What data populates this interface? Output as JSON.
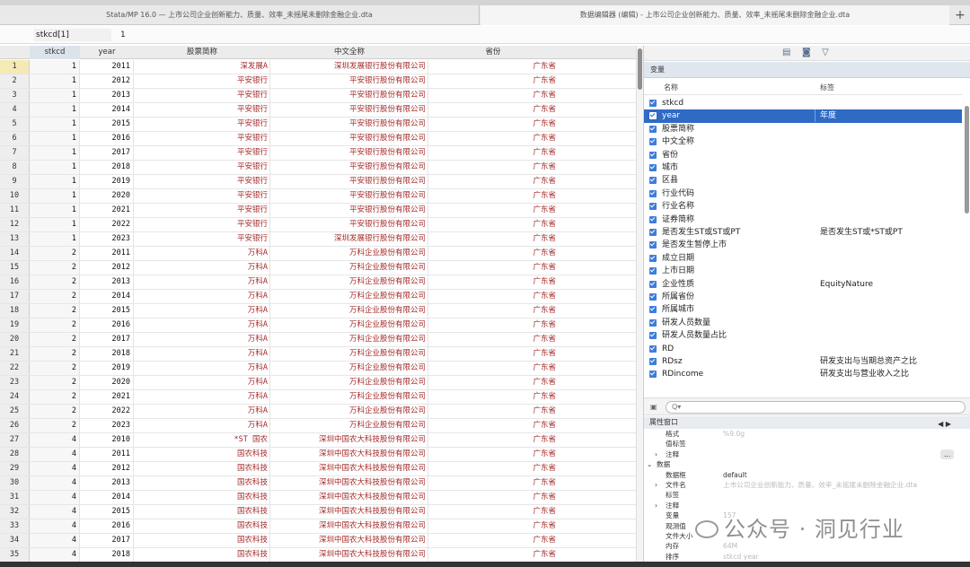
{
  "window": {
    "left_tab": "Stata/MP 16.0 — 上市公司企业创新能力、质量、效率_未摇尾未删除金融企业.dta",
    "right_tab": "数据编辑器 (编辑) - 上市公司企业创新能力、质量、效率_未摇尾未删除金融企业.dta",
    "add_tab": "+"
  },
  "command": {
    "cell": "stkcd[1]",
    "value": "1"
  },
  "grid": {
    "headers": {
      "stkcd": "stkcd",
      "year": "year",
      "abbr": "股票简称",
      "name": "中文全称",
      "prov": "省份"
    },
    "rows": [
      {
        "rn": "1",
        "k": "1",
        "y": "2011",
        "a": "深发展A",
        "n": "深圳发展银行股份有限公司",
        "p": "广东省"
      },
      {
        "rn": "2",
        "k": "1",
        "y": "2012",
        "a": "平安银行",
        "n": "平安银行股份有限公司",
        "p": "广东省"
      },
      {
        "rn": "3",
        "k": "1",
        "y": "2013",
        "a": "平安银行",
        "n": "平安银行股份有限公司",
        "p": "广东省"
      },
      {
        "rn": "4",
        "k": "1",
        "y": "2014",
        "a": "平安银行",
        "n": "平安银行股份有限公司",
        "p": "广东省"
      },
      {
        "rn": "5",
        "k": "1",
        "y": "2015",
        "a": "平安银行",
        "n": "平安银行股份有限公司",
        "p": "广东省"
      },
      {
        "rn": "6",
        "k": "1",
        "y": "2016",
        "a": "平安银行",
        "n": "平安银行股份有限公司",
        "p": "广东省"
      },
      {
        "rn": "7",
        "k": "1",
        "y": "2017",
        "a": "平安银行",
        "n": "平安银行股份有限公司",
        "p": "广东省"
      },
      {
        "rn": "8",
        "k": "1",
        "y": "2018",
        "a": "平安银行",
        "n": "平安银行股份有限公司",
        "p": "广东省"
      },
      {
        "rn": "9",
        "k": "1",
        "y": "2019",
        "a": "平安银行",
        "n": "平安银行股份有限公司",
        "p": "广东省"
      },
      {
        "rn": "10",
        "k": "1",
        "y": "2020",
        "a": "平安银行",
        "n": "平安银行股份有限公司",
        "p": "广东省"
      },
      {
        "rn": "11",
        "k": "1",
        "y": "2021",
        "a": "平安银行",
        "n": "平安银行股份有限公司",
        "p": "广东省"
      },
      {
        "rn": "12",
        "k": "1",
        "y": "2022",
        "a": "平安银行",
        "n": "平安银行股份有限公司",
        "p": "广东省"
      },
      {
        "rn": "13",
        "k": "1",
        "y": "2023",
        "a": "平安银行",
        "n": "深圳发展银行股份有限公司",
        "p": "广东省"
      },
      {
        "rn": "14",
        "k": "2",
        "y": "2011",
        "a": "万科A",
        "n": "万科企业股份有限公司",
        "p": "广东省"
      },
      {
        "rn": "15",
        "k": "2",
        "y": "2012",
        "a": "万科A",
        "n": "万科企业股份有限公司",
        "p": "广东省"
      },
      {
        "rn": "16",
        "k": "2",
        "y": "2013",
        "a": "万科A",
        "n": "万科企业股份有限公司",
        "p": "广东省"
      },
      {
        "rn": "17",
        "k": "2",
        "y": "2014",
        "a": "万科A",
        "n": "万科企业股份有限公司",
        "p": "广东省"
      },
      {
        "rn": "18",
        "k": "2",
        "y": "2015",
        "a": "万科A",
        "n": "万科企业股份有限公司",
        "p": "广东省"
      },
      {
        "rn": "19",
        "k": "2",
        "y": "2016",
        "a": "万科A",
        "n": "万科企业股份有限公司",
        "p": "广东省"
      },
      {
        "rn": "20",
        "k": "2",
        "y": "2017",
        "a": "万科A",
        "n": "万科企业股份有限公司",
        "p": "广东省"
      },
      {
        "rn": "21",
        "k": "2",
        "y": "2018",
        "a": "万科A",
        "n": "万科企业股份有限公司",
        "p": "广东省"
      },
      {
        "rn": "22",
        "k": "2",
        "y": "2019",
        "a": "万科A",
        "n": "万科企业股份有限公司",
        "p": "广东省"
      },
      {
        "rn": "23",
        "k": "2",
        "y": "2020",
        "a": "万科A",
        "n": "万科企业股份有限公司",
        "p": "广东省"
      },
      {
        "rn": "24",
        "k": "2",
        "y": "2021",
        "a": "万科A",
        "n": "万科企业股份有限公司",
        "p": "广东省"
      },
      {
        "rn": "25",
        "k": "2",
        "y": "2022",
        "a": "万科A",
        "n": "万科企业股份有限公司",
        "p": "广东省"
      },
      {
        "rn": "26",
        "k": "2",
        "y": "2023",
        "a": "万科A",
        "n": "万科企业股份有限公司",
        "p": "广东省"
      },
      {
        "rn": "27",
        "k": "4",
        "y": "2010",
        "a": "*ST 国农",
        "n": "深圳中国农大科技股份有限公司",
        "p": "广东省"
      },
      {
        "rn": "28",
        "k": "4",
        "y": "2011",
        "a": "国农科技",
        "n": "深圳中国农大科技股份有限公司",
        "p": "广东省"
      },
      {
        "rn": "29",
        "k": "4",
        "y": "2012",
        "a": "国农科技",
        "n": "深圳中国农大科技股份有限公司",
        "p": "广东省"
      },
      {
        "rn": "30",
        "k": "4",
        "y": "2013",
        "a": "国农科技",
        "n": "深圳中国农大科技股份有限公司",
        "p": "广东省"
      },
      {
        "rn": "31",
        "k": "4",
        "y": "2014",
        "a": "国农科技",
        "n": "深圳中国农大科技股份有限公司",
        "p": "广东省"
      },
      {
        "rn": "32",
        "k": "4",
        "y": "2015",
        "a": "国农科技",
        "n": "深圳中国农大科技股份有限公司",
        "p": "广东省"
      },
      {
        "rn": "33",
        "k": "4",
        "y": "2016",
        "a": "国农科技",
        "n": "深圳中国农大科技股份有限公司",
        "p": "广东省"
      },
      {
        "rn": "34",
        "k": "4",
        "y": "2017",
        "a": "国农科技",
        "n": "深圳中国农大科技股份有限公司",
        "p": "广东省"
      },
      {
        "rn": "35",
        "k": "4",
        "y": "2018",
        "a": "国农科技",
        "n": "深圳中国农大科技股份有限公司",
        "p": "广东省"
      }
    ]
  },
  "variables": {
    "section_title": "变量",
    "col_name": "名称",
    "col_label": "标签",
    "items": [
      {
        "name": "stkcd",
        "label": ""
      },
      {
        "name": "year",
        "label": "年度",
        "selected": true
      },
      {
        "name": "股票简称",
        "label": ""
      },
      {
        "name": "中文全称",
        "label": ""
      },
      {
        "name": "省份",
        "label": ""
      },
      {
        "name": "城市",
        "label": ""
      },
      {
        "name": "区县",
        "label": ""
      },
      {
        "name": "行业代码",
        "label": ""
      },
      {
        "name": "行业名称",
        "label": ""
      },
      {
        "name": "证券简称",
        "label": ""
      },
      {
        "name": "是否发生ST或ST或PT",
        "label": "是否发生ST或*ST或PT"
      },
      {
        "name": "是否发生暂停上市",
        "label": ""
      },
      {
        "name": "成立日期",
        "label": ""
      },
      {
        "name": "上市日期",
        "label": ""
      },
      {
        "name": "企业性质",
        "label": "EquityNature"
      },
      {
        "name": "所属省份",
        "label": ""
      },
      {
        "name": "所属城市",
        "label": ""
      },
      {
        "name": "研发人员数量",
        "label": ""
      },
      {
        "name": "研发人员数量占比",
        "label": ""
      },
      {
        "name": "RD",
        "label": ""
      },
      {
        "name": "RDsz",
        "label": "研发支出与当期总资产之比"
      },
      {
        "name": "RDincome",
        "label": "研发支出与营业收入之比"
      }
    ],
    "filter_placeholder": "Q▾"
  },
  "properties": {
    "title": "属性窗口",
    "nav": "◀ ▶",
    "rows": [
      {
        "k": "格式",
        "v": "%9.0g",
        "indent": 1,
        "faded": true
      },
      {
        "k": "值标签",
        "v": "",
        "indent": 1
      },
      {
        "k": "注释",
        "v": "",
        "indent": 1,
        "chev": "›",
        "btn": "..."
      },
      {
        "k": "数据",
        "v": "",
        "indent": 0,
        "chev": "⌄"
      },
      {
        "k": "数据框",
        "v": "default",
        "indent": 1
      },
      {
        "k": "文件名",
        "v": "上市公司企业创新能力、质量、效率_未摇尾未删除金融企业.dta",
        "indent": 1,
        "chev": "›",
        "faded": true
      },
      {
        "k": "标签",
        "v": "",
        "indent": 1
      },
      {
        "k": "注释",
        "v": "",
        "indent": 1,
        "chev": "›"
      },
      {
        "k": "变量",
        "v": "157",
        "indent": 1,
        "faded": true
      },
      {
        "k": "观测值",
        "v": "",
        "indent": 1
      },
      {
        "k": "文件大小",
        "v": "",
        "indent": 1
      },
      {
        "k": "内存",
        "v": "64M",
        "indent": 1,
        "faded": true
      },
      {
        "k": "排序",
        "v": "stkcd year",
        "indent": 1,
        "faded": true
      }
    ]
  },
  "watermark": "公众号 · 洞见行业"
}
